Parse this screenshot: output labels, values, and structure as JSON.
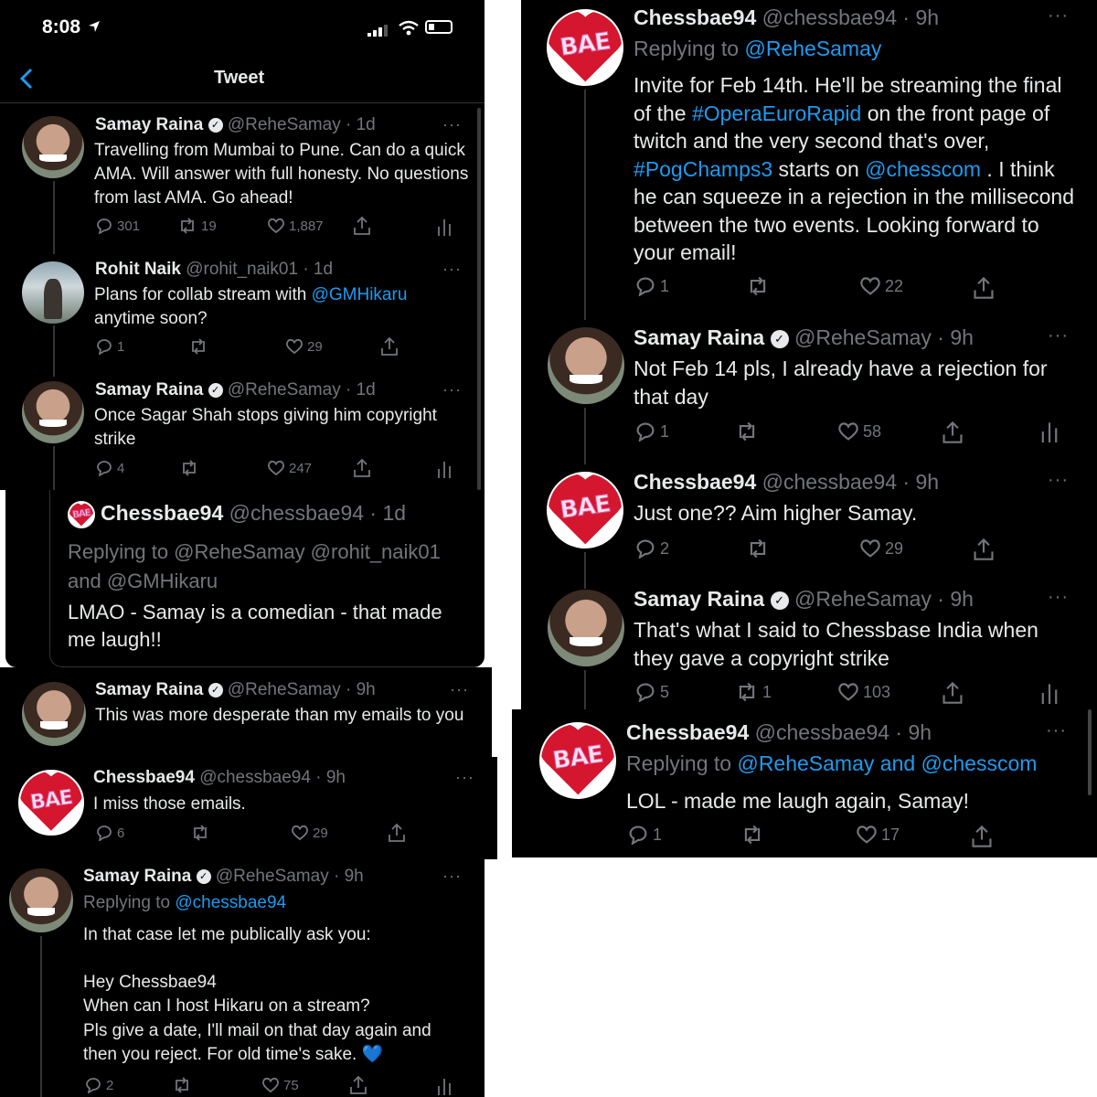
{
  "status_bar": {
    "time": "8:08"
  },
  "header": {
    "title": "Tweet",
    "back_icon": "chevron-left-icon"
  },
  "left": {
    "t1": {
      "name": "Samay Raina",
      "handle": "@ReheSamay · 1d",
      "text": "Travelling from Mumbai to Pune. Can do a quick AMA. Will answer with full honesty. No questions from last AMA. Go ahead!",
      "replies": "301",
      "retweets": "19",
      "likes": "1,887"
    },
    "t2": {
      "name": "Rohit Naik",
      "handle": "@rohit_naik01 · 1d",
      "text_a": "Plans for collab stream with ",
      "mention": "@GMHikaru",
      "text_b": " anytime soon?",
      "replies": "1",
      "likes": "29"
    },
    "t3": {
      "name": "Samay Raina",
      "handle": "@ReheSamay · 1d",
      "text": "Once Sagar Shah stops giving him copyright strike",
      "replies": "4",
      "likes": "247"
    },
    "t4": {
      "name": "Chessbae94",
      "handle": "@chessbae94 · 1d",
      "reply_line1": "Replying to @ReheSamay @rohit_naik01",
      "reply_line2": "and @GMHikaru",
      "text": "LMAO - Samay is a comedian - that made me laugh!!"
    },
    "t5": {
      "name": "Samay Raina",
      "handle": "@ReheSamay · 9h",
      "text": "This was more desperate than my emails to you"
    },
    "t6": {
      "name": "Chessbae94",
      "handle": "@chessbae94 · 9h",
      "text": "I miss those emails.",
      "replies": "6",
      "likes": "29"
    },
    "t7": {
      "name": "Samay Raina",
      "handle": "@ReheSamay · 9h",
      "replying_prefix": "Replying to ",
      "replying_to": "@chessbae94",
      "lines": [
        "In that case let me publically ask you:",
        "",
        "Hey Chessbae94",
        "When can I host Hikaru on a stream?",
        "Pls give a date, I'll mail on that day again and",
        "then you reject. For old time's sake. 💙"
      ],
      "replies": "2",
      "likes": "75"
    }
  },
  "right": {
    "r1": {
      "name": "Chessbae94",
      "handle": "@chessbae94 · 9h",
      "replying_prefix": "Replying to ",
      "replying_to": "@ReheSamay",
      "text_1": "Invite for Feb 14th. He'll be streaming the final of the ",
      "tag_1": "#OperaEuroRapid",
      "text_2": " on the front page of twitch and the very second that's over, ",
      "tag_2": "#PogChamps3",
      "text_3": " starts on ",
      "tag_3": "@chesscom",
      "text_4": " . I think he can squeeze in a rejection in the millisecond between the two events. Looking forward to your email!",
      "replies": "1",
      "likes": "22"
    },
    "r2": {
      "name": "Samay Raina",
      "handle": "@ReheSamay · 9h",
      "text": "Not Feb 14 pls, I already have a rejection for that day",
      "replies": "1",
      "likes": "58"
    },
    "r3": {
      "name": "Chessbae94",
      "handle": "@chessbae94 · 9h",
      "text": "Just one?? Aim higher Samay.",
      "replies": "2",
      "likes": "29"
    },
    "r4": {
      "name": "Samay Raina",
      "handle": "@ReheSamay · 9h",
      "text": "That's what I said to Chessbase India when they gave a copyright strike",
      "replies": "5",
      "retweets": "1",
      "likes": "103"
    },
    "r5": {
      "name": "Chessbae94",
      "handle": "@chessbae94 · 9h",
      "replying_prefix": "Replying to ",
      "replying_to": "@ReheSamay and @chesscom",
      "text": "LOL - made me laugh again, Samay!",
      "replies": "1",
      "likes": "17"
    }
  },
  "avatar_badge_text": "BAE",
  "verified_mark": "✓",
  "more_dots": "···",
  "colors": {
    "link": "#1d9bf0",
    "muted": "#71767b",
    "background": "#000000"
  }
}
